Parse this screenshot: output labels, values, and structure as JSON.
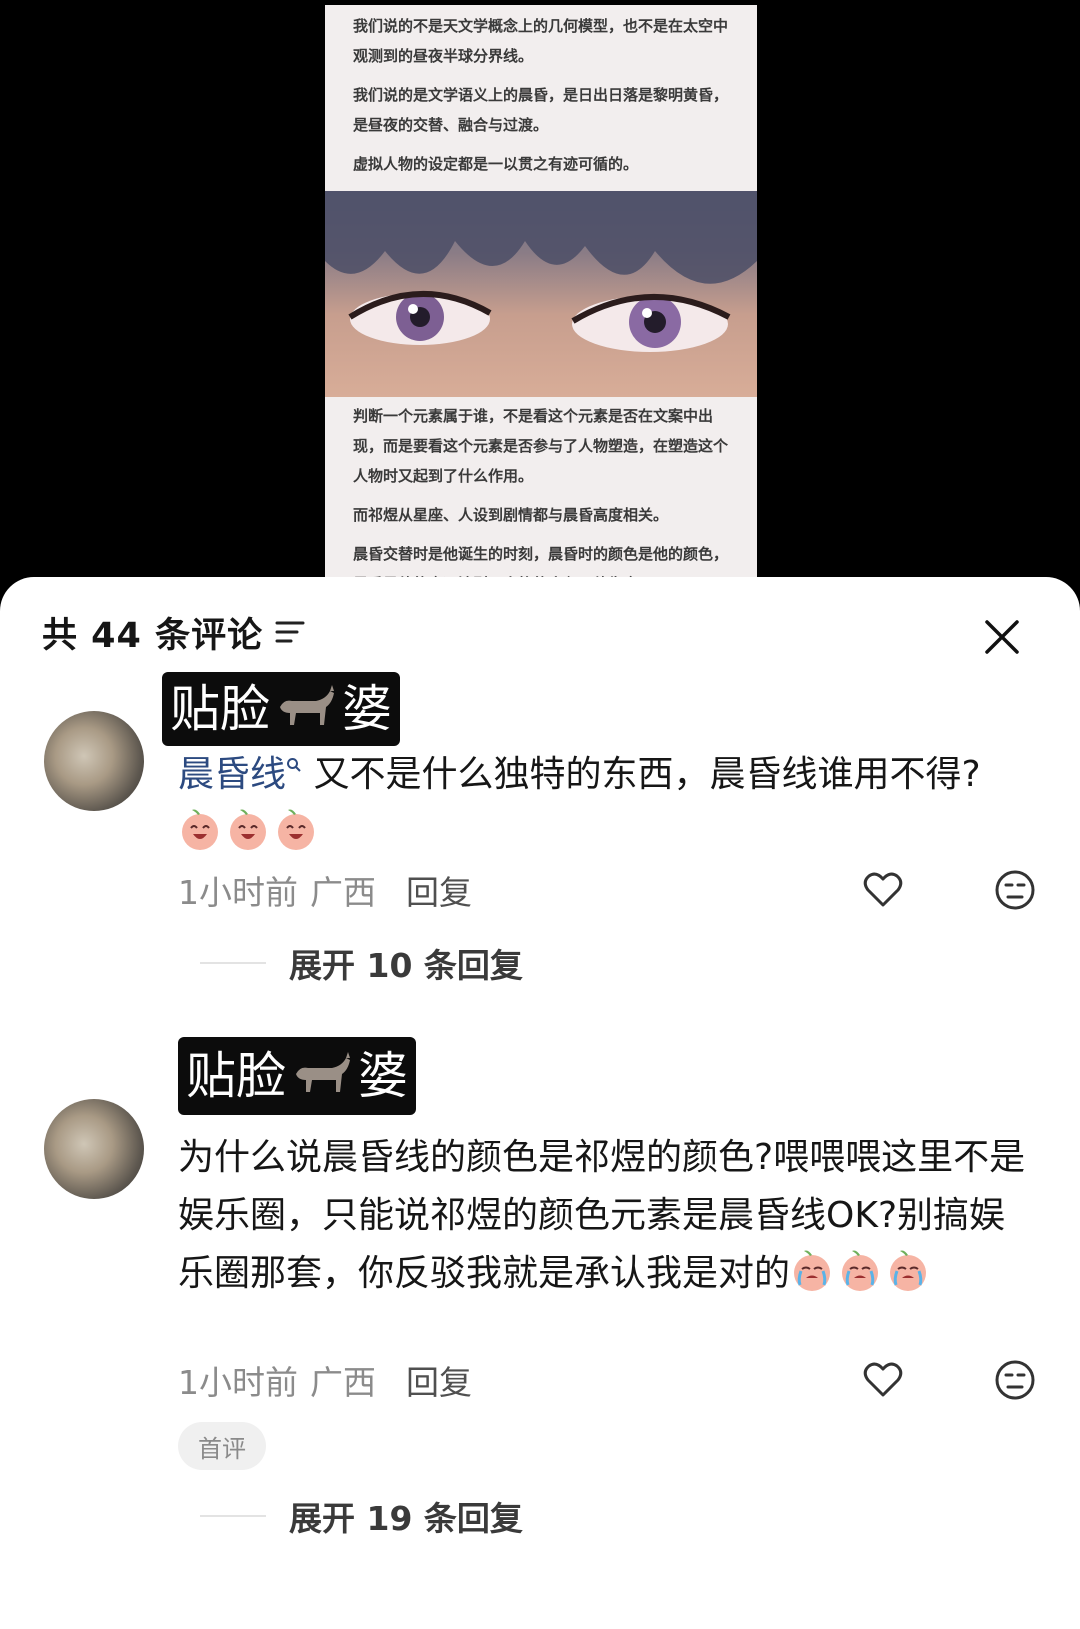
{
  "post": {
    "paragraphs_top": [
      "我们说的不是天文学概念上的几何模型，也不是在太空中观测到的昼夜半球分界线。",
      "我们说的是文学语义上的晨昏，是日出日落是黎明黄昏，是昼夜的交替、融合与过渡。",
      "虚拟人物的设定都是一以贯之有迹可循的。"
    ],
    "paragraphs_bottom": [
      "判断一个元素属于谁，不是看这个元素是否在文案中出现，而是要看这个元素是否参与了人物塑造，在塑造这个人物时又起到了什么作用。",
      "而祁煜从星座、人设到剧情都与晨昏高度相关。",
      "晨昏交替时是他诞生的时刻，晨昏时的颜色是他的颜色，晨昏是他的命运法则，人格的底色，他生命"
    ]
  },
  "header": {
    "title": "共 44 条评论"
  },
  "comments": [
    {
      "name_before": "贴脸",
      "name_after": "婆",
      "hashtag": "晨昏线",
      "text": "又不是什么独特的东西，晨昏线谁用不得?",
      "time": "1小时前",
      "location": "广西",
      "reply_label": "回复",
      "expand_label": "展开 10 条回复"
    },
    {
      "name_before": "贴脸",
      "name_after": "婆",
      "text": "为什么说晨昏线的颜色是祁煜的颜色?喂喂喂这里不是娱乐圈，只能说祁煜的颜色元素是晨昏线OK?别搞娱乐圈那套，你反驳我就是承认我是对的",
      "time": "1小时前",
      "location": "广西",
      "reply_label": "回复",
      "badge": "首评",
      "expand_label": "展开 19 条回复"
    }
  ],
  "icons": {
    "sort": "sort-lines-icon",
    "close": "close-icon",
    "like": "heart-icon",
    "dislike": "neutral-face-icon",
    "name_emoji": "donkey-icon",
    "comment1_emoji": "laughing-peach-face-icon",
    "comment2_emoji": "crying-peach-face-icon"
  },
  "colors": {
    "hashtag": "#2c4a80",
    "meta": "#8b8b8b",
    "name_badge_bg": "#0c0c0c"
  }
}
